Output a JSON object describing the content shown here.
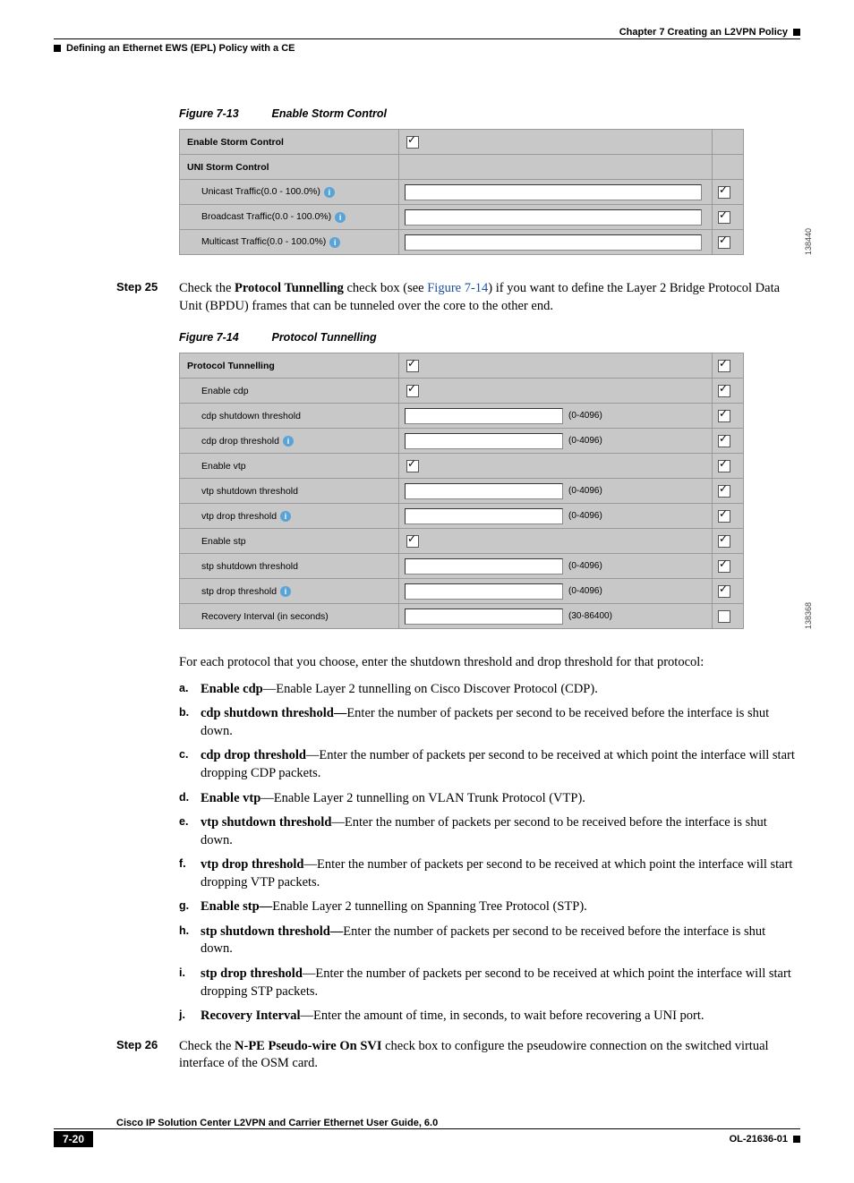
{
  "header": {
    "chapter": "Chapter 7      Creating an L2VPN Policy",
    "section": "Defining an Ethernet EWS (EPL) Policy with a CE"
  },
  "figure13": {
    "num": "Figure 7-13",
    "title": "Enable Storm Control",
    "imgid": "138440",
    "rows": {
      "enable_label": "Enable Storm Control",
      "uni_label": "UNI Storm Control",
      "unicast": "Unicast Traffic(0.0 - 100.0%)",
      "broadcast": "Broadcast Traffic(0.0 - 100.0%)",
      "multicast": "Multicast Traffic(0.0 - 100.0%)"
    }
  },
  "step25": {
    "label": "Step 25",
    "pre": "Check the ",
    "bold": "Protocol Tunnelling",
    "mid": " check box (see ",
    "ref": "Figure 7-14",
    "post": ") if you want to define the Layer 2 Bridge Protocol Data Unit (BPDU) frames that can be tunneled over the core to the other end."
  },
  "figure14": {
    "num": "Figure 7-14",
    "title": "Protocol Tunnelling",
    "imgid": "138368",
    "rows": {
      "pt": "Protocol Tunnelling",
      "en_cdp": "Enable cdp",
      "cdp_shut": "cdp shutdown threshold",
      "cdp_drop": "cdp drop threshold",
      "en_vtp": "Enable vtp",
      "vtp_shut": "vtp shutdown threshold",
      "vtp_drop": "vtp drop threshold",
      "en_stp": "Enable stp",
      "stp_shut": "stp shutdown threshold",
      "stp_drop": "stp drop threshold",
      "recov": "Recovery Interval (in seconds)",
      "r1": "(0-4096)",
      "r2": "(30-86400)"
    }
  },
  "leadin": "For each protocol that you choose, enter the shutdown threshold and drop threshold for that protocol:",
  "list": {
    "a": {
      "tag": "a.",
      "b": "Enable cdp",
      "t": "—Enable Layer 2 tunnelling on Cisco Discover Protocol (CDP)."
    },
    "b": {
      "tag": "b.",
      "b": "cdp shutdown threshold—",
      "t": "Enter the number of packets per second to be received before the interface is shut down."
    },
    "c": {
      "tag": "c.",
      "b": "cdp drop threshold",
      "t": "—Enter the number of packets per second to be received at which point the interface will start dropping CDP packets."
    },
    "d": {
      "tag": "d.",
      "b": "Enable vtp",
      "t": "—Enable Layer 2 tunnelling on VLAN Trunk Protocol (VTP)."
    },
    "e": {
      "tag": "e.",
      "b": "vtp shutdown threshold",
      "t": "—Enter the number of packets per second to be received before the interface is shut down."
    },
    "f": {
      "tag": "f.",
      "b": "vtp drop threshold",
      "t": "—Enter the number of packets per second to be received at which point the interface will start dropping VTP packets."
    },
    "g": {
      "tag": "g.",
      "b": "Enable stp—",
      "t": "Enable Layer 2 tunnelling on Spanning Tree Protocol (STP)."
    },
    "h": {
      "tag": "h.",
      "b": "stp shutdown threshold—",
      "t": "Enter the number of packets per second to be received before the interface is shut down."
    },
    "i": {
      "tag": "i.",
      "b": "stp drop threshold",
      "t": "—Enter the number of packets per second to be received at which point the interface will start dropping STP packets."
    },
    "j": {
      "tag": "j.",
      "b": "Recovery Interval",
      "t": "—Enter the amount of time, in seconds, to wait before recovering a UNI port."
    }
  },
  "step26": {
    "label": "Step 26",
    "pre": "Check the ",
    "bold": "N-PE Pseudo-wire On SVI",
    "post": " check box to configure the pseudowire connection on the switched virtual interface of the OSM card."
  },
  "footer": {
    "guide": "Cisco IP Solution Center L2VPN and Carrier Ethernet User Guide, 6.0",
    "page": "7-20",
    "docnum": "OL-21636-01"
  },
  "info_glyph": "i"
}
